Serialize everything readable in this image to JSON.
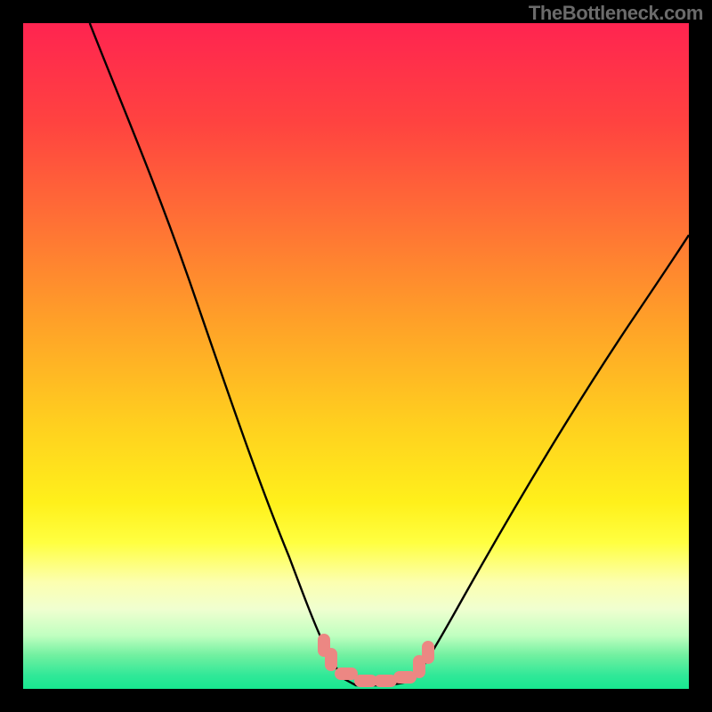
{
  "watermark": "TheBottleneck.com",
  "chart_data": {
    "type": "line",
    "title": "",
    "xlabel": "",
    "ylabel": "",
    "xlim": [
      0,
      100
    ],
    "ylim": [
      0,
      100
    ],
    "background_gradient": {
      "type": "vertical",
      "stops": [
        {
          "pos": 0,
          "color": "#ff2450"
        },
        {
          "pos": 15,
          "color": "#ff4340"
        },
        {
          "pos": 30,
          "color": "#ff7135"
        },
        {
          "pos": 45,
          "color": "#ffa128"
        },
        {
          "pos": 60,
          "color": "#ffcf1f"
        },
        {
          "pos": 72,
          "color": "#fff01b"
        },
        {
          "pos": 78,
          "color": "#ffff40"
        },
        {
          "pos": 84,
          "color": "#fcffb0"
        },
        {
          "pos": 88,
          "color": "#f0ffd0"
        },
        {
          "pos": 92,
          "color": "#c0ffc0"
        },
        {
          "pos": 95,
          "color": "#70f0a0"
        },
        {
          "pos": 98,
          "color": "#30e898"
        },
        {
          "pos": 100,
          "color": "#18e890"
        }
      ]
    },
    "series": [
      {
        "name": "bottleneck-curve",
        "color": "#000000",
        "x": [
          10,
          15,
          20,
          25,
          30,
          35,
          40,
          42,
          45,
          48,
          50,
          52,
          55,
          58,
          60,
          65,
          70,
          75,
          80,
          85,
          90,
          95,
          100
        ],
        "y": [
          100,
          90,
          78,
          64,
          50,
          36,
          22,
          16,
          8,
          3,
          1,
          0,
          0,
          0,
          1,
          5,
          12,
          20,
          28,
          37,
          45,
          53,
          60
        ]
      }
    ],
    "annotations": [
      {
        "name": "min-region-markers",
        "description": "salmon rounded markers near curve minimum",
        "color": "#ec8783",
        "points": [
          {
            "x": 45,
            "y": 7
          },
          {
            "x": 46,
            "y": 5
          },
          {
            "x": 48,
            "y": 2
          },
          {
            "x": 50,
            "y": 1
          },
          {
            "x": 52,
            "y": 0.5
          },
          {
            "x": 54,
            "y": 0.5
          },
          {
            "x": 56,
            "y": 1
          },
          {
            "x": 58,
            "y": 1.5
          },
          {
            "x": 60,
            "y": 3
          },
          {
            "x": 61,
            "y": 4.5
          }
        ]
      }
    ]
  }
}
